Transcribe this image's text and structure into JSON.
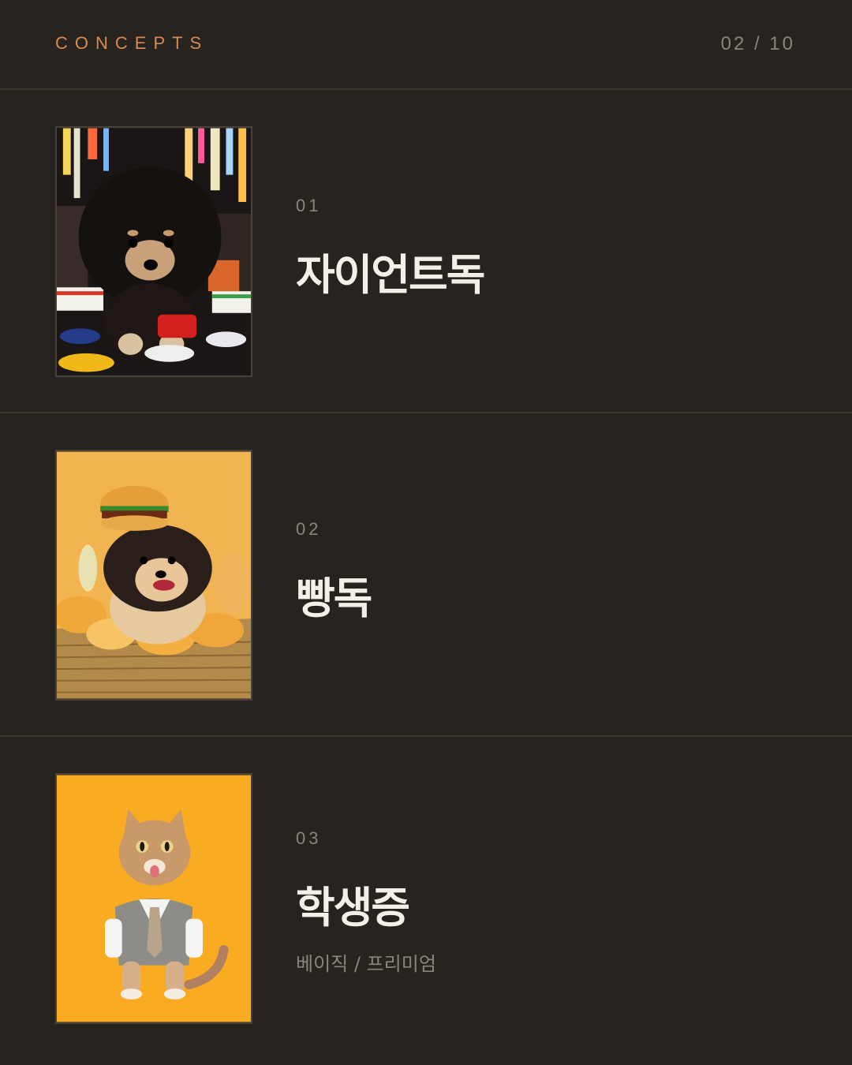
{
  "header": {
    "brand": "CONCEPTS",
    "pager": "02 / 10"
  },
  "concepts": [
    {
      "number": "01",
      "title": "자이언트독",
      "image": "giant-dog-city-photo"
    },
    {
      "number": "02",
      "title": "빵독",
      "image": "bread-dog-basket-photo"
    },
    {
      "number": "03",
      "title": "학생증",
      "subtitle": "베이직 / 프리미엄",
      "image": "student-cat-photo"
    }
  ],
  "colors": {
    "background": "#27231f",
    "accent": "#d98a52",
    "muted": "#8c847b",
    "title": "#f4efe8"
  }
}
